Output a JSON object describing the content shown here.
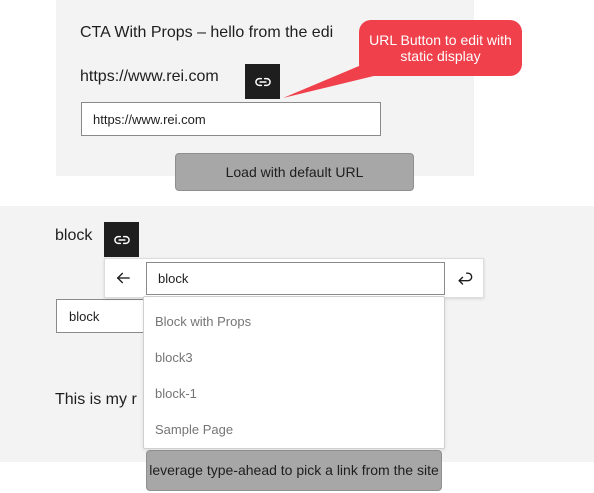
{
  "top": {
    "cta_title": "CTA With Props – hello from the edi",
    "url_display": "https://www.rei.com",
    "url_input_value": "https://www.rei.com",
    "load_button_label": "Load with default URL"
  },
  "callout": {
    "text": "URL Button to edit with static display",
    "color": "#f0404b"
  },
  "bottom": {
    "block_text": "block",
    "search_value": "block",
    "block_input_value": "block",
    "my_text": "This is my r",
    "suggestions": [
      "Block with Props",
      "block3",
      "block-1",
      "Sample Page"
    ],
    "typeahead_label": "leverage type-ahead to pick a link from the site"
  },
  "icons": {
    "link": "link-icon",
    "back": "arrow-left-icon",
    "submit": "enter-return-icon"
  }
}
